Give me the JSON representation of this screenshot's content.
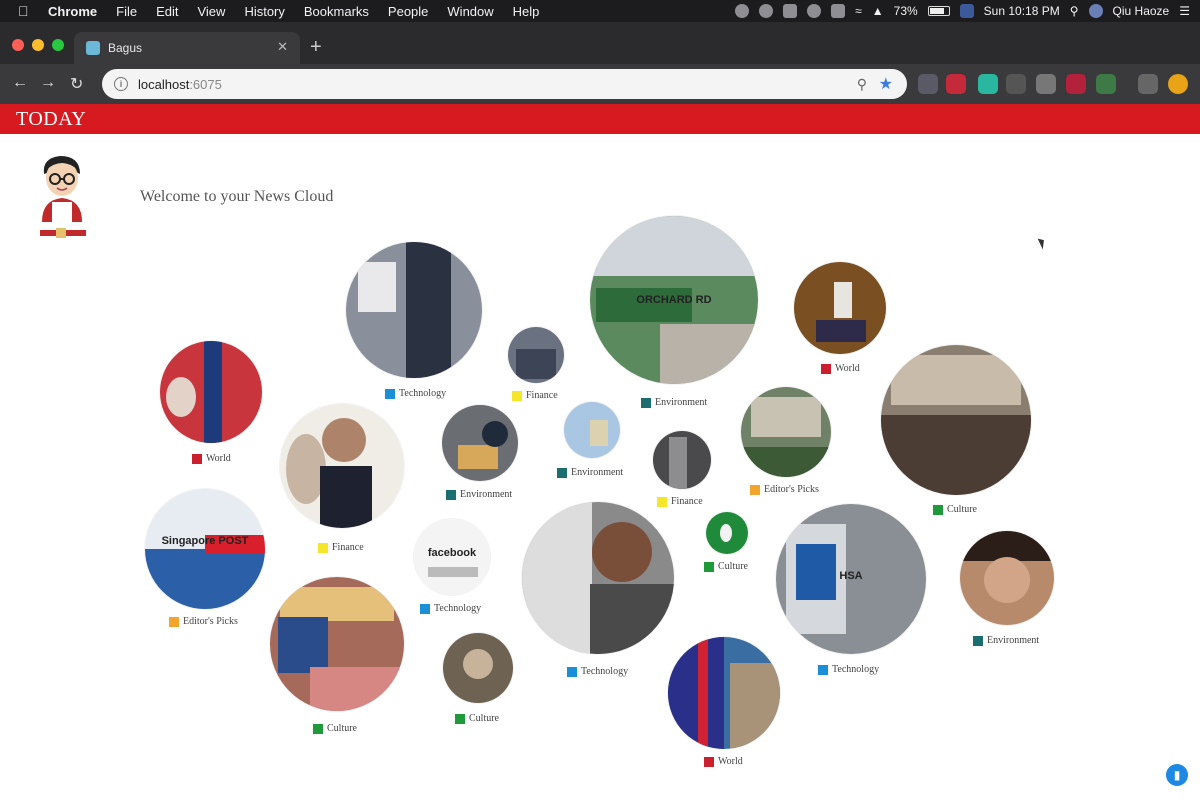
{
  "menubar": {
    "items": [
      "Chrome",
      "File",
      "Edit",
      "View",
      "History",
      "Bookmarks",
      "People",
      "Window",
      "Help"
    ],
    "battery": "73%",
    "clock": "Sun 10:18 PM",
    "user": "Qiu Haoze"
  },
  "browser": {
    "tab_title": "Bagus",
    "url_host": "localhost",
    "url_port": ":6075"
  },
  "site": {
    "brand": "TODAY",
    "welcome": "Welcome to your News Cloud"
  },
  "bubbles": [
    {
      "category": "Technology",
      "color": "#1a8fd8",
      "text": ""
    },
    {
      "category": "Finance",
      "color": "#f5e62a",
      "text": ""
    },
    {
      "category": "Environment",
      "color": "#1b6e70",
      "text": "ORCHARD RD"
    },
    {
      "category": "World",
      "color": "#cc1f2e",
      "text": ""
    },
    {
      "category": "World",
      "color": "#cc1f2e",
      "text": ""
    },
    {
      "category": "Environment",
      "color": "#1b6e70",
      "text": ""
    },
    {
      "category": "Environment",
      "color": "#1b6e70",
      "text": ""
    },
    {
      "category": "Finance",
      "color": "#f5e62a",
      "text": ""
    },
    {
      "category": "Editor's Picks",
      "color": "#f3a42b",
      "text": ""
    },
    {
      "category": "Culture",
      "color": "#1f9a3a",
      "text": ""
    },
    {
      "category": "Finance",
      "color": "#f5e62a",
      "text": ""
    },
    {
      "category": "Editor's Picks",
      "color": "#f3a42b",
      "text": "Singapore POST"
    },
    {
      "category": "Technology",
      "color": "#1a8fd8",
      "text": "facebook"
    },
    {
      "category": "Technology",
      "color": "#1a8fd8",
      "text": ""
    },
    {
      "category": "Culture",
      "color": "#1f9a3a",
      "text": ""
    },
    {
      "category": "Technology",
      "color": "#1a8fd8",
      "text": "HSA"
    },
    {
      "category": "Environment",
      "color": "#1b6e70",
      "text": ""
    },
    {
      "category": "Culture",
      "color": "#1f9a3a",
      "text": ""
    },
    {
      "category": "Culture",
      "color": "#1f9a3a",
      "text": ""
    },
    {
      "category": "World",
      "color": "#cc1f2e",
      "text": ""
    }
  ]
}
